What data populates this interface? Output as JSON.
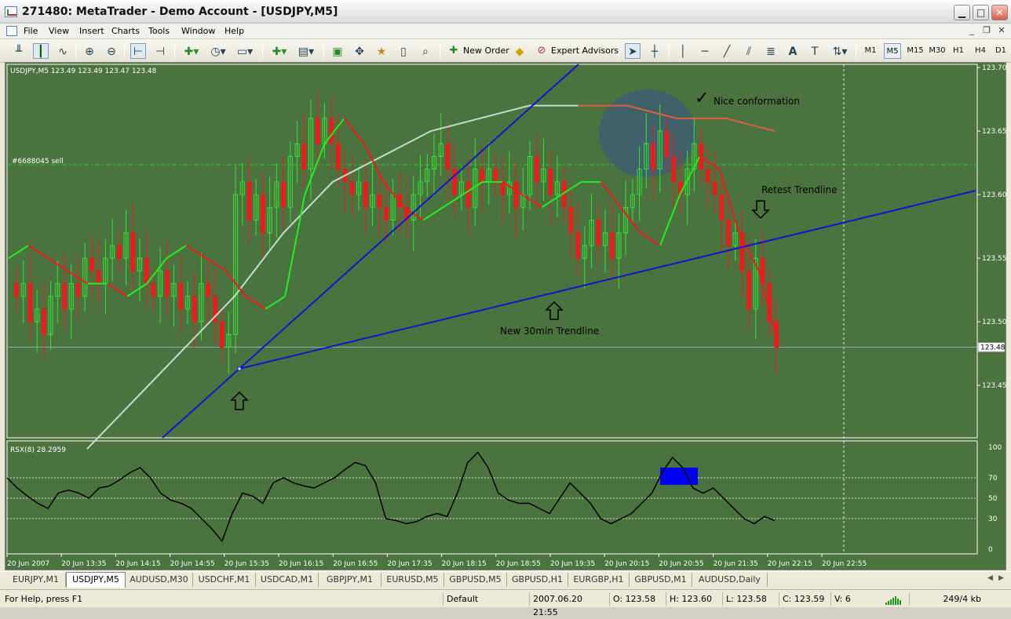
{
  "window": {
    "title": "271480: MetaTrader - Demo Account - [USDJPY,M5]",
    "controls": {
      "minimize": "▁",
      "maximize": "□",
      "close": "✕"
    }
  },
  "menu": {
    "items": [
      "File",
      "View",
      "Insert",
      "Charts",
      "Tools",
      "Window",
      "Help"
    ],
    "mdi_controls": {
      "minimize": "_",
      "restore": "❐",
      "close": "✕"
    }
  },
  "toolbar": {
    "new_order_label": "New Order",
    "expert_advisors_label": "Expert Advisors",
    "timeframes": [
      "M1",
      "M5",
      "M15",
      "M30",
      "H1",
      "H4",
      "D1"
    ],
    "active_timeframe": "M5",
    "icons": [
      "bar-chart-icon",
      "candlestick-chart-icon",
      "line-chart-icon",
      "zoom-in-icon",
      "zoom-out-icon",
      "chart-shift-icon",
      "autoscroll-icon",
      "indicators-icon",
      "periods-icon",
      "templates-icon",
      "new-chart-icon",
      "profiles-icon",
      "navigator-icon",
      "crosshair-target-icon",
      "favorites-icon",
      "terminal-icon",
      "strategy-tester-icon",
      "cursor-icon",
      "crosshair-icon",
      "vertical-line-icon",
      "horizontal-line-icon",
      "trendline-icon",
      "equidistant-channel-icon",
      "fibonacci-icon",
      "text-icon",
      "text-label-icon",
      "arrows-icon"
    ]
  },
  "chart": {
    "symbol_header": "USDJPY,M5  123.49 123.49 123.47 123.48",
    "order_label": "#6688045 sell",
    "current_price_tag": "123.48",
    "annotations": {
      "nice_confirmation": "Nice conformation",
      "checkmark": "✓",
      "retest_trendline": "Retest Trendline",
      "new_30min_trendline": "New 30min Trendline"
    },
    "indicator_header": "RSX(8) 28.2959",
    "colors": {
      "background": "#4b7340",
      "bull_candle": "#33e633",
      "bear_candle": "#e61e1e",
      "trendline": "#1414c8",
      "slow_ma": "#c4dccf",
      "fast_ma_up": "#22ee22",
      "fast_ma_down": "#ee1a1a",
      "rsx_line": "#000000",
      "highlight_box": "#0000ee",
      "highlight_circle": "#3f5f6f"
    }
  },
  "chart_data": [
    {
      "type": "candlestick",
      "title": "USDJPY,M5",
      "y_ticks": [
        "123.70",
        "123.65",
        "123.60",
        "123.55",
        "123.50",
        "123.45"
      ],
      "ylim": [
        123.4,
        123.7
      ],
      "x_ticks": [
        "20 Jun 2007",
        "20 Jun 13:35",
        "20 Jun 14:15",
        "20 Jun 14:55",
        "20 Jun 15:35",
        "20 Jun 16:15",
        "20 Jun 16:55",
        "20 Jun 17:35",
        "20 Jun 18:15",
        "20 Jun 18:55",
        "20 Jun 19:35",
        "20 Jun 20:15",
        "20 Jun 20:55",
        "20 Jun 21:35",
        "20 Jun 22:15",
        "20 Jun 22:55"
      ],
      "close_series": [
        123.52,
        123.53,
        123.5,
        123.51,
        123.49,
        123.52,
        123.53,
        123.51,
        123.53,
        123.52,
        123.55,
        123.54,
        123.53,
        123.55,
        123.56,
        123.55,
        123.57,
        123.54,
        123.55,
        123.53,
        123.52,
        123.54,
        123.52,
        123.53,
        123.51,
        123.52,
        123.5,
        123.53,
        123.52,
        123.5,
        123.48,
        123.49,
        123.6,
        123.61,
        123.58,
        123.6,
        123.57,
        123.59,
        123.61,
        123.59,
        123.63,
        123.64,
        123.62,
        123.66,
        123.64,
        123.66,
        123.64,
        123.62,
        123.61,
        123.6,
        123.61,
        123.59,
        123.6,
        123.59,
        123.58,
        123.6,
        123.59,
        123.58,
        123.6,
        123.61,
        123.62,
        123.63,
        123.64,
        123.62,
        123.6,
        123.61,
        123.59,
        123.62,
        123.61,
        123.62,
        123.61,
        123.6,
        123.61,
        123.59,
        123.6,
        123.63,
        123.61,
        123.62,
        123.6,
        123.61,
        123.59,
        123.57,
        123.55,
        123.56,
        123.58,
        123.56,
        123.57,
        123.55,
        123.57,
        123.59,
        123.6,
        123.62,
        123.64,
        123.62,
        123.65,
        123.63,
        123.61,
        123.6,
        123.62,
        123.64,
        123.62,
        123.61,
        123.6,
        123.58,
        123.56,
        123.57,
        123.54,
        123.51,
        123.55,
        123.53,
        123.5,
        123.48
      ],
      "fast_ma": [
        123.55,
        123.56,
        123.55,
        123.54,
        123.53,
        123.53,
        123.52,
        123.53,
        123.55,
        123.56,
        123.55,
        123.54,
        123.52,
        123.51,
        123.52,
        123.6,
        123.64,
        123.66,
        123.64,
        123.61,
        123.59,
        123.58,
        123.59,
        123.6,
        123.61,
        123.61,
        123.6,
        123.59,
        123.6,
        123.61,
        123.61,
        123.59,
        123.57,
        123.56,
        123.6,
        123.63,
        123.62,
        123.57,
        123.54,
        123.48
      ],
      "slow_ma": [
        123.4,
        123.44,
        123.48,
        123.52,
        123.57,
        123.61,
        123.63,
        123.65,
        123.66,
        123.67,
        123.67,
        123.67,
        123.66,
        123.66,
        123.65
      ],
      "trendlines": [
        {
          "name": "New 30min Trendline",
          "from": [
            "20 Jun 15:35",
            123.47
          ],
          "to": [
            "20 Jun 22:55",
            123.59
          ]
        },
        {
          "name": "",
          "from": [
            "20 Jun 14:15",
            123.4
          ],
          "to": [
            "20 Jun 18:55",
            123.7
          ]
        }
      ]
    },
    {
      "type": "line",
      "title": "RSX(8) 28.2959",
      "y_ticks": [
        "100",
        "70",
        "50",
        "30",
        "0"
      ],
      "ylim": [
        0,
        100
      ],
      "levels": [
        70,
        50,
        30
      ],
      "series": [
        {
          "name": "RSX(8)",
          "values": [
            70,
            60,
            52,
            45,
            40,
            55,
            58,
            55,
            50,
            60,
            62,
            68,
            75,
            80,
            70,
            55,
            48,
            45,
            40,
            30,
            20,
            8,
            35,
            55,
            52,
            45,
            65,
            70,
            65,
            62,
            60,
            65,
            70,
            78,
            85,
            82,
            65,
            30,
            28,
            25,
            27,
            32,
            35,
            32,
            55,
            85,
            95,
            80,
            55,
            48,
            45,
            45,
            40,
            35,
            50,
            65,
            55,
            45,
            30,
            25,
            30,
            35,
            45,
            55,
            75,
            90,
            80,
            60,
            55,
            60,
            50,
            40,
            30,
            25,
            32,
            28
          ]
        }
      ]
    }
  ],
  "tabs": {
    "items": [
      "EURJPY,M1",
      "USDJPY,M5",
      "AUDUSD,M30",
      "USDCHF,M1",
      "USDCAD,M1",
      "GBPJPY,M1",
      "EURUSD,M5",
      "GBPUSD,M5",
      "GBPUSD,H1",
      "EURGBP,H1",
      "GBPUSD,M1",
      "AUDUSD,Daily"
    ],
    "active": "USDJPY,M5"
  },
  "status": {
    "help": "For Help, press F1",
    "profile": "Default",
    "datetime": "2007.06.20 21:55",
    "open": "O: 123.58",
    "high": "H: 123.60",
    "low": "L: 123.58",
    "close": "C: 123.59",
    "volume": "V: 6",
    "traffic": "249/4 kb"
  }
}
